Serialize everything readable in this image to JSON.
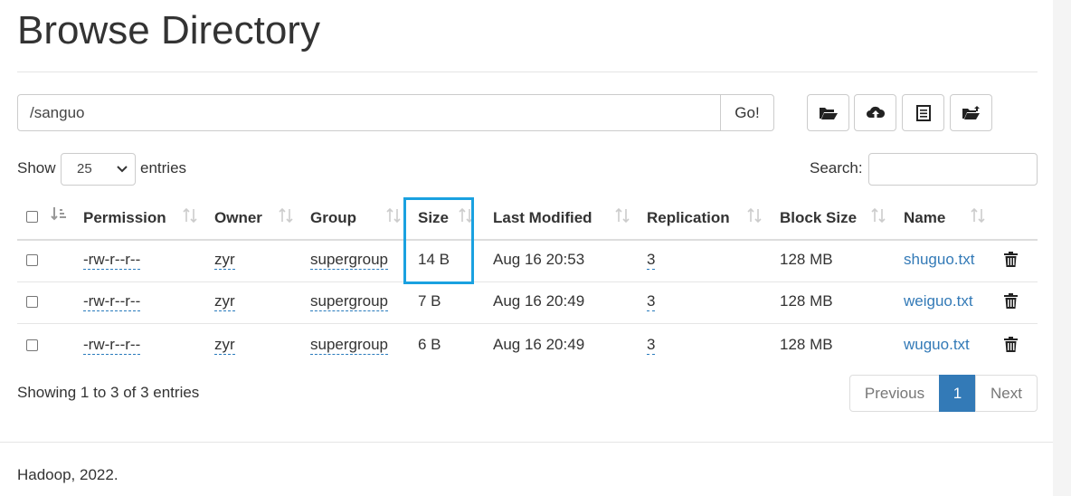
{
  "page": {
    "title": "Browse Directory"
  },
  "toolbar": {
    "path_value": "/sanguo",
    "go_label": "Go!",
    "icons": [
      "folder-open-icon",
      "cloud-upload-icon",
      "list-icon",
      "folder-upload-icon"
    ]
  },
  "table_controls": {
    "show_label": "Show",
    "entries_value": "25",
    "entries_label": "entries",
    "search_label": "Search:",
    "search_value": ""
  },
  "table": {
    "headers": [
      "Permission",
      "Owner",
      "Group",
      "Size",
      "Last Modified",
      "Replication",
      "Block Size",
      "Name"
    ],
    "rows": [
      {
        "permission": "-rw-r--r--",
        "owner": "zyr",
        "group": "supergroup",
        "size": "14 B",
        "modified": "Aug 16 20:53",
        "replication": "3",
        "block_size": "128 MB",
        "name": "shuguo.txt"
      },
      {
        "permission": "-rw-r--r--",
        "owner": "zyr",
        "group": "supergroup",
        "size": "7 B",
        "modified": "Aug 16 20:49",
        "replication": "3",
        "block_size": "128 MB",
        "name": "weiguo.txt"
      },
      {
        "permission": "-rw-r--r--",
        "owner": "zyr",
        "group": "supergroup",
        "size": "6 B",
        "modified": "Aug 16 20:49",
        "replication": "3",
        "block_size": "128 MB",
        "name": "wuguo.txt"
      }
    ],
    "highlight_color": "#1aa1e0"
  },
  "pagination": {
    "summary": "Showing 1 to 3 of 3 entries",
    "previous": "Previous",
    "current": "1",
    "next": "Next"
  },
  "footer": {
    "text": "Hadoop, 2022."
  },
  "colors": {
    "link": "#337ab7",
    "active_page": "#337ab7"
  }
}
